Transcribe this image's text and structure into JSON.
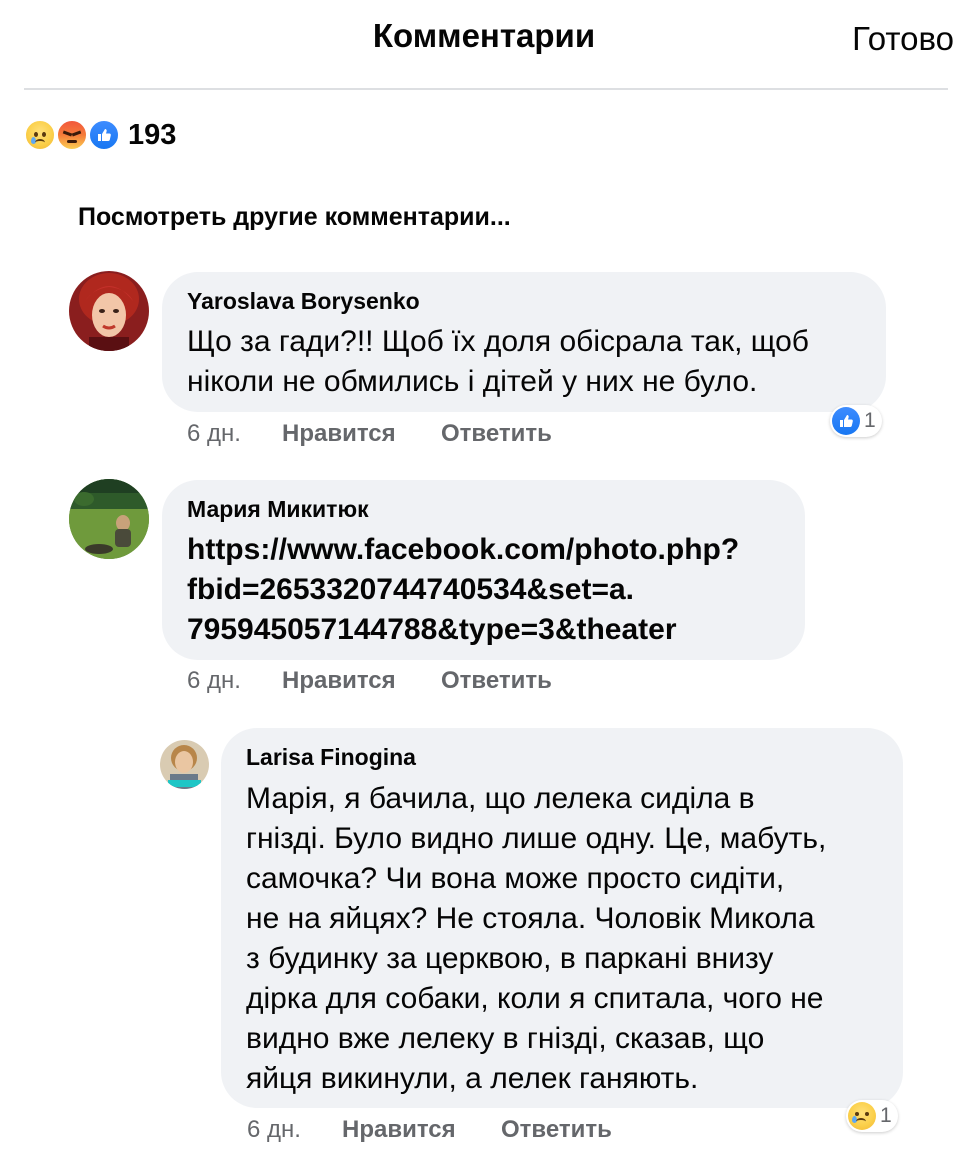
{
  "header": {
    "title": "Комментарии",
    "done_label": "Готово"
  },
  "reactions_summary": {
    "icons": [
      "sad-reaction-icon",
      "angry-reaction-icon",
      "like-reaction-icon"
    ],
    "count": "193"
  },
  "see_more_label": "Посмотреть другие комментарии...",
  "comments": [
    {
      "author": "Yaroslava Borysenko",
      "text": "Що за гади?!! Щоб їх доля обісрала так, щоб\nніколи не обмились і дітей у них не було.",
      "time": "6 дн.",
      "like_label": "Нравится",
      "reply_label": "Ответить",
      "reaction_icon": "like-reaction-icon",
      "reaction_count": "1"
    },
    {
      "author": "Мария Микитюк",
      "text": "https://www.facebook.com/photo.php?\nfbid=2653320744740534&set=a.\n795945057144788&type=3&theater",
      "time": "6 дн.",
      "like_label": "Нравится",
      "reply_label": "Ответить"
    },
    {
      "author": "Larisa Finogina",
      "text": "Марія, я бачила, що лелека сиділа в\nгнізді. Було видно лише одну. Це, мабуть,\nсамочка? Чи вона може просто сидіти,\nне на яйцях? Не стояла. Чоловік Микола\nз будинку за церквою, в паркані внизу\nдірка для собаки, коли я спитала, чого не\nвидно вже лелеку в гнізді, сказав, що\nяйця викинули, а лелек ганяють.",
      "time": "6 дн.",
      "like_label": "Нравится",
      "reply_label": "Ответить",
      "reaction_icon": "sad-reaction-icon",
      "reaction_count": "1"
    }
  ],
  "colors": {
    "bubble": "#f0f2f5",
    "meta_text": "#65676b",
    "like_blue": "#1877f2",
    "divider": "#dddfe2"
  }
}
